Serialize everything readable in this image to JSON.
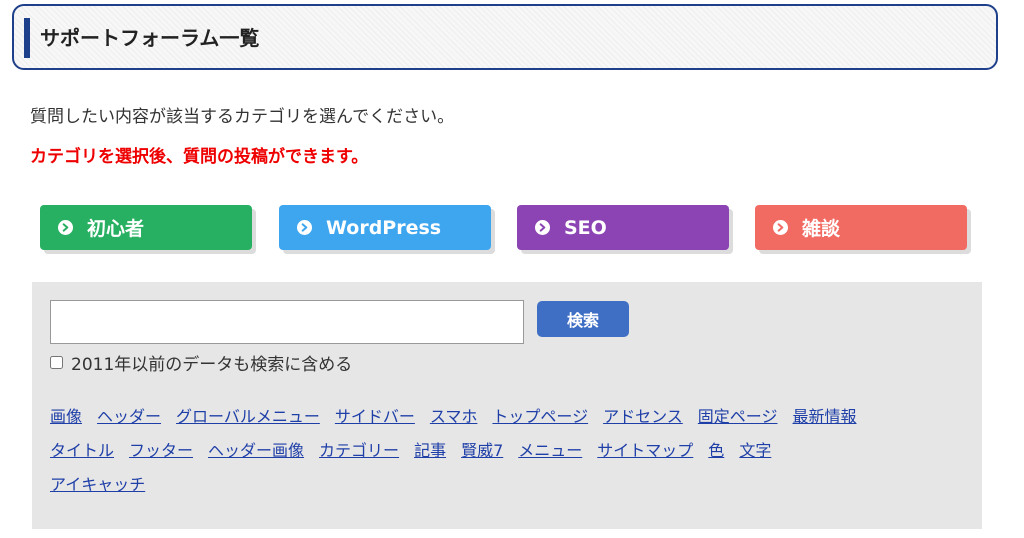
{
  "header": {
    "title": "サポートフォーラム一覧"
  },
  "intro": {
    "text": "質問したい内容が該当するカテゴリを選んでください。",
    "notice": "カテゴリを選択後、質問の投稿ができます。",
    "notice_color": "#ee0000"
  },
  "categories": [
    {
      "label": "初心者",
      "color": "#28b062"
    },
    {
      "label": "WordPress",
      "color": "#3ea6ef"
    },
    {
      "label": "SEO",
      "color": "#8c44b4"
    },
    {
      "label": "雑談",
      "color": "#f26b63"
    }
  ],
  "search": {
    "input_value": "",
    "button_label": "検索",
    "button_color": "#3f6fc4",
    "archive_label": "2011年以前のデータも検索に含める",
    "archive_checked": false
  },
  "tags": {
    "rows": [
      [
        "画像",
        "ヘッダー",
        "グローバルメニュー",
        "サイドバー",
        "スマホ",
        "トップページ",
        "アドセンス",
        "固定ページ",
        "最新情報"
      ],
      [
        "タイトル",
        "フッター",
        "ヘッダー画像",
        "カテゴリー",
        "記事",
        "賢威7",
        "メニュー",
        "サイトマップ",
        "色",
        "文字"
      ],
      [
        "アイキャッチ"
      ]
    ],
    "color": "#1f3fa8"
  }
}
